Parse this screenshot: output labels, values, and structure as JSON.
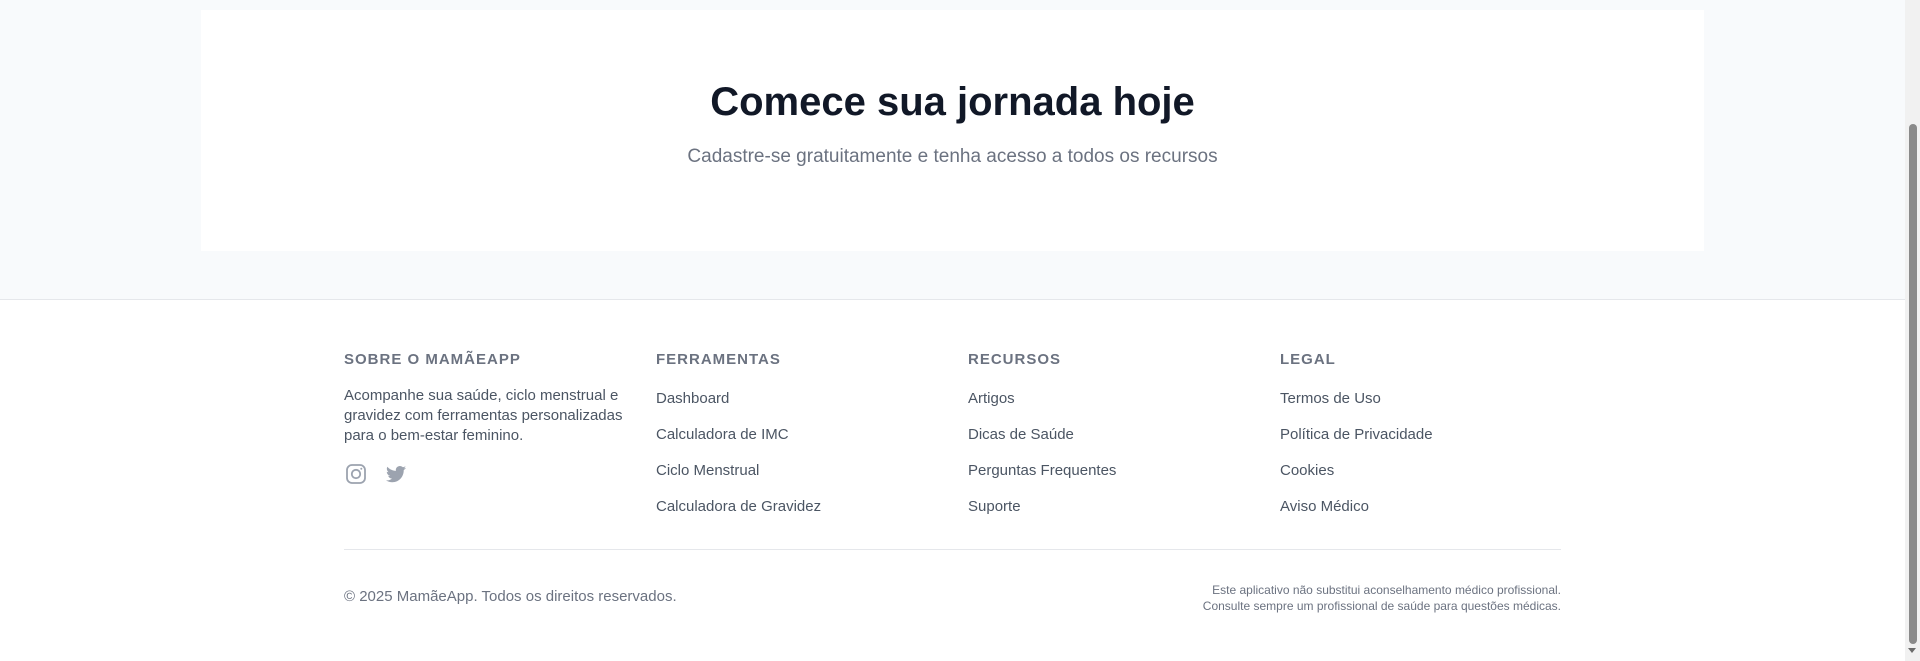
{
  "cta": {
    "title": "Comece sua jornada hoje",
    "subtitle": "Cadastre-se gratuitamente e tenha acesso a todos os recursos"
  },
  "footer": {
    "about": {
      "heading": "SOBRE O MAMÃEAPP",
      "text": "Acompanhe sua saúde, ciclo menstrual e gravidez com ferramentas personalizadas para o bem-estar feminino.",
      "social": [
        "instagram-icon",
        "twitter-icon"
      ]
    },
    "tools": {
      "heading": "FERRAMENTAS",
      "items": [
        "Dashboard",
        "Calculadora de IMC",
        "Ciclo Menstrual",
        "Calculadora de Gravidez"
      ]
    },
    "resources": {
      "heading": "RECURSOS",
      "items": [
        "Artigos",
        "Dicas de Saúde",
        "Perguntas Frequentes",
        "Suporte"
      ]
    },
    "legal": {
      "heading": "LEGAL",
      "items": [
        "Termos de Uso",
        "Política de Privacidade",
        "Cookies",
        "Aviso Médico"
      ]
    },
    "copyright": "© 2025 MamãeApp. Todos os direitos reservados.",
    "disclaimer_line1": "Este aplicativo não substitui aconselhamento médico profissional.",
    "disclaimer_line2": "Consulte sempre um profissional de saúde para questões médicas."
  },
  "colors": {
    "heading": "#111827",
    "muted": "#6b7280",
    "text": "#4b5563",
    "background": "#f8fafc",
    "divider": "#e5e7eb"
  }
}
